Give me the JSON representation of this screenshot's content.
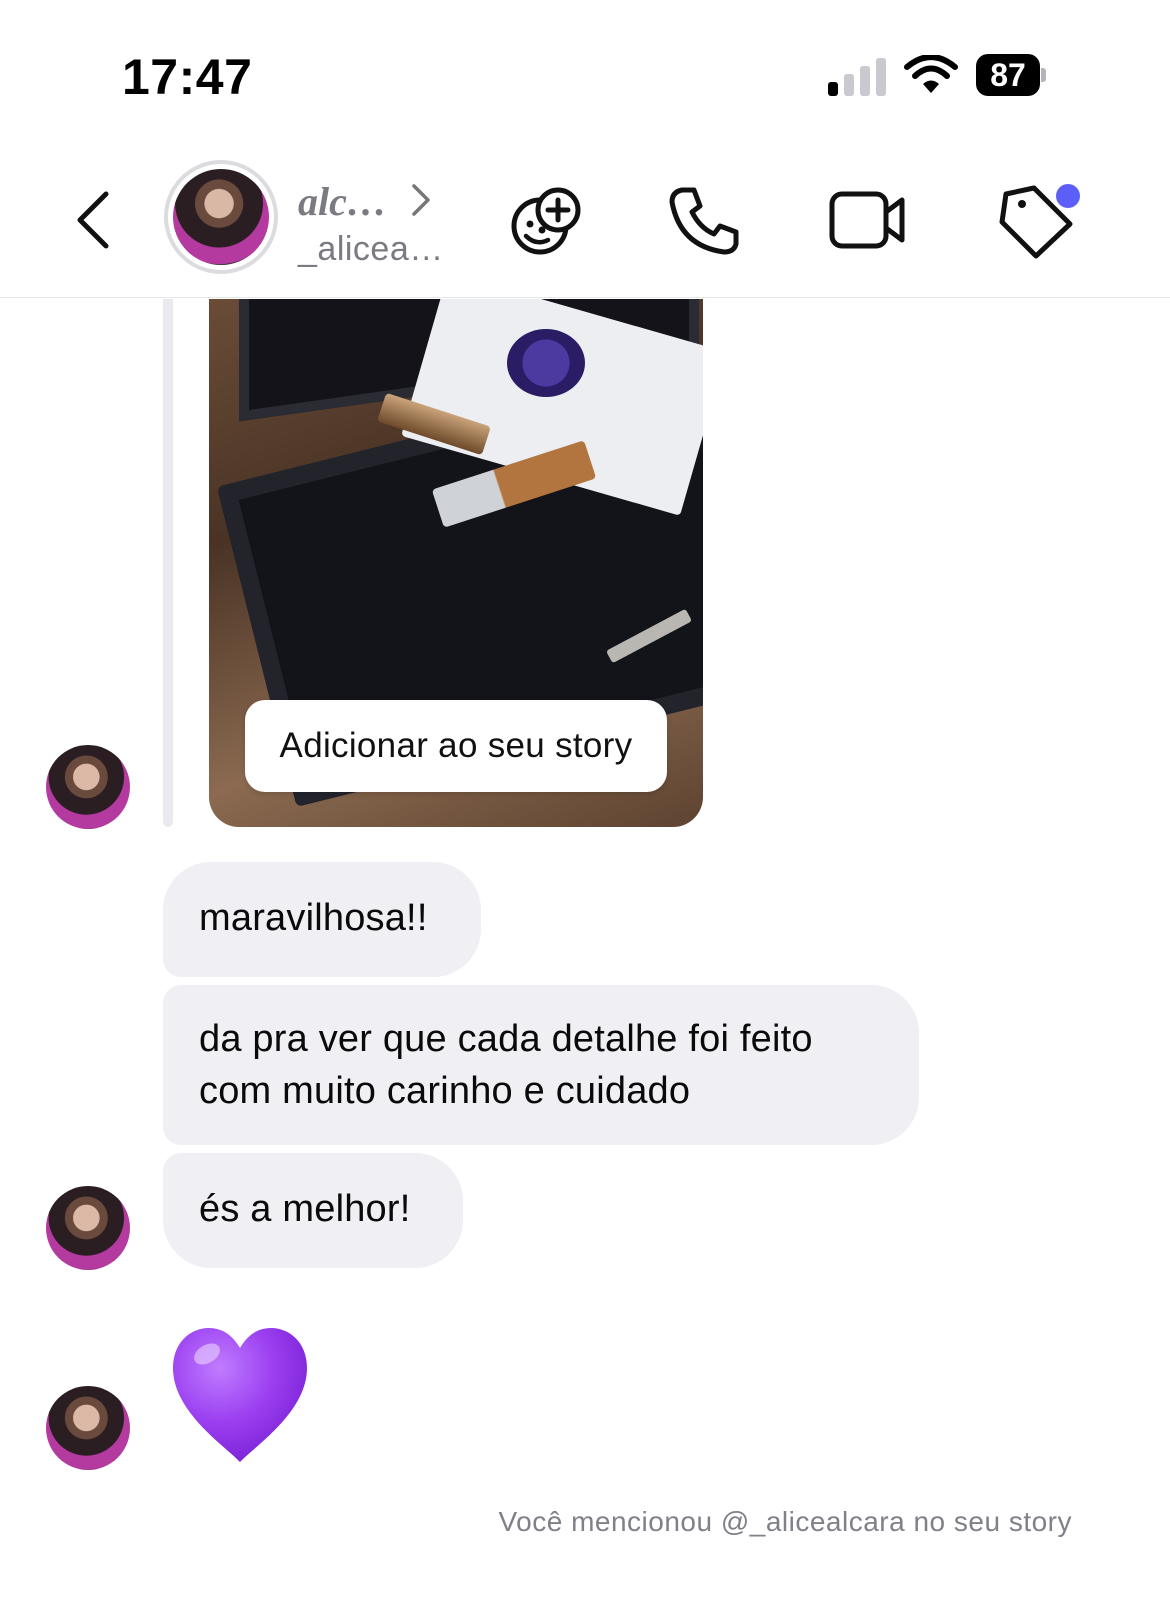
{
  "status_bar": {
    "time": "17:47",
    "battery": "87"
  },
  "header": {
    "name": "alc…",
    "username": "_alicea…",
    "icons": [
      "back-chevron-icon",
      "effects-icon",
      "phone-icon",
      "video-icon",
      "tag-icon"
    ],
    "accent": "#5b5ff7"
  },
  "story": {
    "add_button": "Adicionar ao seu story"
  },
  "messages": [
    {
      "text": "maravilhosa!!"
    },
    {
      "text": "da pra ver que cada detalhe foi feito\ncom muito carinho e cuidado"
    },
    {
      "text": "és a melhor!"
    },
    {
      "emoji": "purple-heart"
    }
  ],
  "footer": {
    "mention": "Você mencionou @_alicealcara no seu story"
  }
}
